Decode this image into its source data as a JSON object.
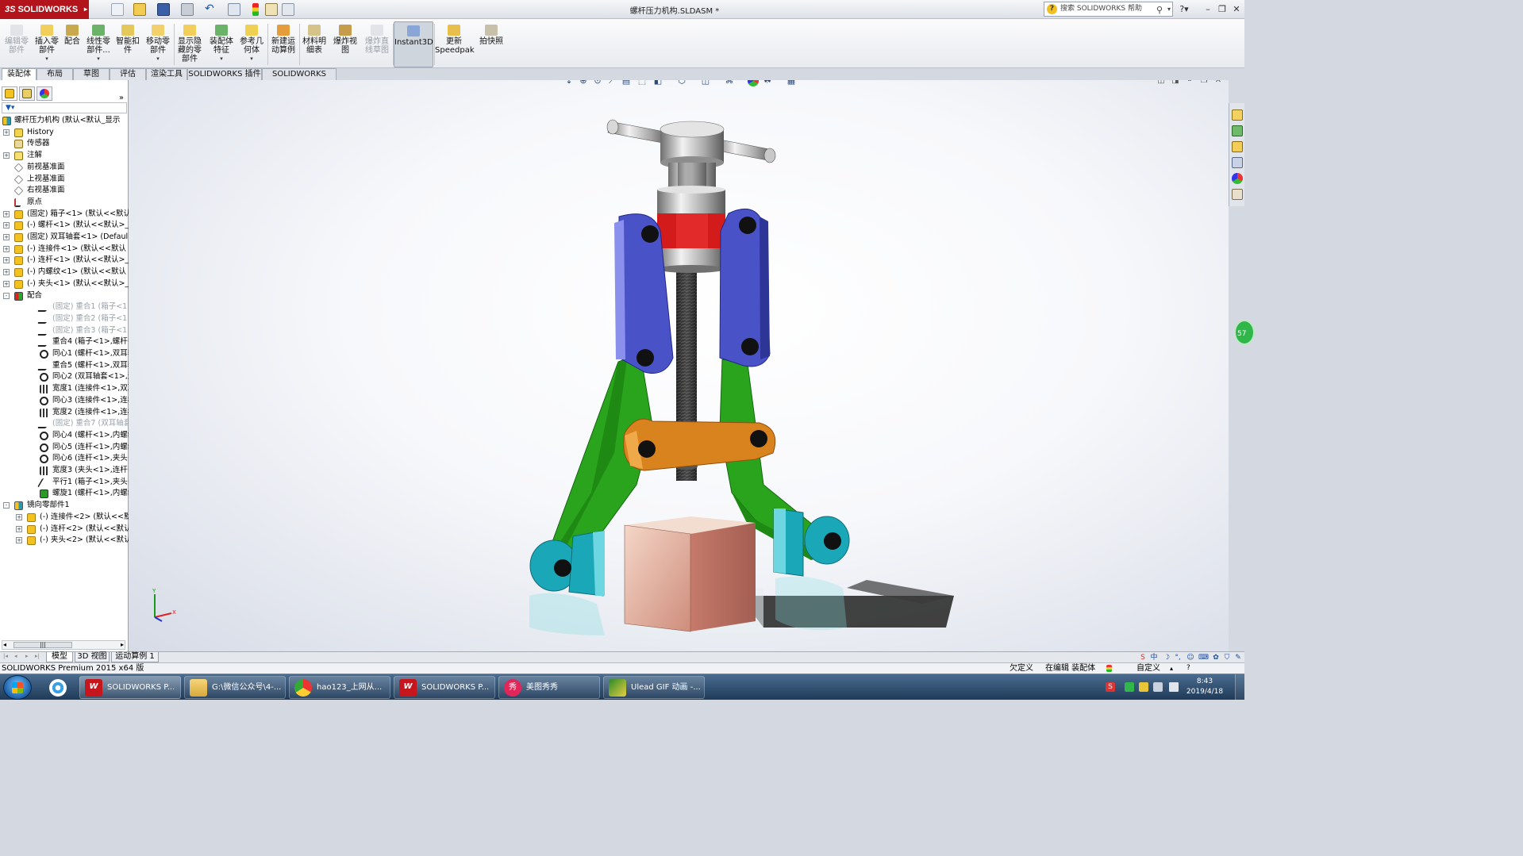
{
  "app": {
    "logo_text": "SOLIDWORKS",
    "window_title": "螺杆压力机构.SLDASM *",
    "help_search_placeholder": "搜索 SOLIDWORKS 帮助"
  },
  "commands": [
    {
      "label": "编辑零\n部件",
      "disabled": true
    },
    {
      "label": "插入零\n部件",
      "dropdown": true
    },
    {
      "label": "配合"
    },
    {
      "label": "线性零\n部件...",
      "dropdown": true
    },
    {
      "label": "智能扣\n件"
    },
    {
      "label": "移动零\n部件",
      "dropdown": true
    },
    {
      "label": "显示隐\n藏的零\n部件"
    },
    {
      "label": "装配体\n特征",
      "dropdown": true
    },
    {
      "label": "参考几\n何体",
      "dropdown": true
    },
    {
      "label": "新建运\n动算例"
    },
    {
      "label": "材料明\n细表"
    },
    {
      "label": "爆炸视\n图"
    },
    {
      "label": "爆炸直\n线草图",
      "disabled": true
    },
    {
      "label": "Instant3D",
      "active": true
    },
    {
      "label": "更新\nSpeedpak"
    },
    {
      "label": "拍快照"
    }
  ],
  "cm_tabs": [
    "装配体",
    "布局",
    "草图",
    "评估",
    "渲染工具",
    "SOLIDWORKS 插件",
    "SOLIDWORKS MBD"
  ],
  "feature_tree": {
    "root": "螺杆压力机构 (默认<默认_显示",
    "nodes": [
      {
        "label": "History",
        "icon": "hist",
        "exp": "+"
      },
      {
        "label": "传感器",
        "icon": "sensor"
      },
      {
        "label": "注解",
        "icon": "note",
        "exp": "+"
      },
      {
        "label": "前视基准面",
        "icon": "plane"
      },
      {
        "label": "上视基准面",
        "icon": "plane"
      },
      {
        "label": "右视基准面",
        "icon": "plane"
      },
      {
        "label": "原点",
        "icon": "origin"
      },
      {
        "label": "(固定) 箱子<1> (默认<<默认",
        "icon": "yellow",
        "exp": "+"
      },
      {
        "label": "(-) 螺杆<1> (默认<<默认>_",
        "icon": "yellow",
        "exp": "+"
      },
      {
        "label": "(固定) 双耳轴套<1> (Defaul",
        "icon": "yellow",
        "exp": "+"
      },
      {
        "label": "(-) 连接件<1> (默认<<默认",
        "icon": "yellow",
        "exp": "+"
      },
      {
        "label": "(-) 连杆<1> (默认<<默认>_",
        "icon": "yellow",
        "exp": "+"
      },
      {
        "label": "(-) 内螺纹<1> (默认<<默认",
        "icon": "yellow",
        "exp": "+"
      },
      {
        "label": "(-) 夹头<1> (默认<<默认>_",
        "icon": "yellow",
        "exp": "+"
      },
      {
        "label": "配合",
        "icon": "mates",
        "exp": "-"
      },
      {
        "label": "(固定) 重合1 (箱子<1>,前",
        "icon": "coinc",
        "indent": 2,
        "gray": true
      },
      {
        "label": "(固定) 重合2 (箱子<1>,上",
        "icon": "coinc",
        "indent": 2,
        "gray": true
      },
      {
        "label": "(固定) 重合3 (箱子<1>,右",
        "icon": "coinc",
        "indent": 2,
        "gray": true
      },
      {
        "label": "重合4 (箱子<1>,螺杆<1",
        "icon": "coinc",
        "indent": 2
      },
      {
        "label": "同心1 (螺杆<1>,双耳轴套",
        "icon": "conc",
        "indent": 2
      },
      {
        "label": "重合5 (螺杆<1>,双耳轴套",
        "icon": "coinc",
        "indent": 2
      },
      {
        "label": "同心2 (双耳轴套<1>,连接",
        "icon": "conc",
        "indent": 2
      },
      {
        "label": "宽度1 (连接件<1>,双耳轴",
        "icon": "width",
        "indent": 2
      },
      {
        "label": "同心3 (连接件<1>,连杆<",
        "icon": "conc",
        "indent": 2
      },
      {
        "label": "宽度2 (连接件<1>,连杆<",
        "icon": "width",
        "indent": 2
      },
      {
        "label": "(固定) 重合7 (双耳轴套<",
        "icon": "coinc",
        "indent": 2,
        "gray": true
      },
      {
        "label": "同心4 (螺杆<1>,内螺纹<",
        "icon": "conc",
        "indent": 2
      },
      {
        "label": "同心5 (连杆<1>,内螺纹<",
        "icon": "conc",
        "indent": 2
      },
      {
        "label": "同心6 (连杆<1>,夹头<1>",
        "icon": "conc",
        "indent": 2
      },
      {
        "label": "宽度3 (夹头<1>,连杆<1",
        "icon": "width",
        "indent": 2
      },
      {
        "label": "平行1 (箱子<1>,夹头<1>",
        "icon": "par",
        "indent": 2
      },
      {
        "label": "螺旋1 (螺杆<1>,内螺纹<",
        "icon": "screw",
        "indent": 2
      },
      {
        "label": "镜向零部件1",
        "icon": "mirror",
        "exp": "-"
      },
      {
        "label": "(-) 连接件<2> (默认<<默",
        "icon": "yellow",
        "exp": "+",
        "indent": 1
      },
      {
        "label": "(-) 连杆<2> (默认<<默认",
        "icon": "yellow",
        "exp": "+",
        "indent": 1
      },
      {
        "label": "(-) 夹头<2> (默认<<默认",
        "icon": "yellow",
        "exp": "+",
        "indent": 1
      }
    ]
  },
  "bottom_tabs": [
    "模型",
    "3D 视图",
    "运动算例 1"
  ],
  "statusbar": {
    "product": "SOLIDWORKS Premium 2015 x64 版",
    "underdefined": "欠定义",
    "editing": "在编辑 装配体",
    "custom": "自定义"
  },
  "taskbar": [
    {
      "label": "SOLIDWORKS P...",
      "icon": "sw",
      "badge": "W",
      "active": true
    },
    {
      "label": "G:\\微信公众号\\4-...",
      "icon": "folder"
    },
    {
      "label": "hao123_上网从...",
      "icon": "chrome"
    },
    {
      "label": "SOLIDWORKS P...",
      "icon": "sw",
      "badge": "W"
    },
    {
      "label": "美图秀秀",
      "icon": "meitu",
      "badge": "秀"
    },
    {
      "label": "Ulead GIF 动画 -...",
      "icon": "ulead"
    }
  ],
  "clock": {
    "time": "8:43",
    "date": "2019/4/18"
  },
  "fps_badge": "57",
  "colors": {
    "sw_red": "#b3141b",
    "link_blue": "#4a52c8",
    "arm_green": "#2aa41c",
    "crossbar_orange": "#d9831f",
    "jaw_cyan": "#1aa7b8",
    "collar_red": "#d31b1b"
  }
}
